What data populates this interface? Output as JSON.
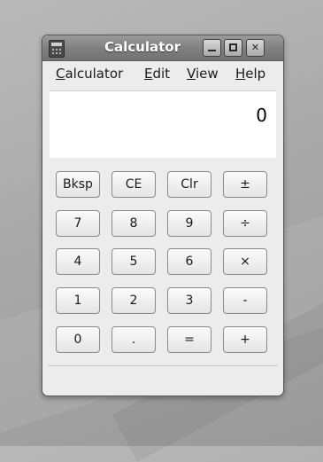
{
  "window": {
    "title": "Calculator",
    "controls": {
      "minimize": "minimize-icon",
      "maximize": "maximize-icon",
      "close": "✕"
    }
  },
  "menubar": {
    "items": [
      {
        "mnemonic": "C",
        "rest": "alculator"
      },
      {
        "mnemonic": "E",
        "rest": "dit"
      },
      {
        "mnemonic": "V",
        "rest": "iew"
      },
      {
        "mnemonic": "H",
        "rest": "elp"
      }
    ]
  },
  "display": {
    "value": "0"
  },
  "keypad": {
    "rows": [
      [
        "Bksp",
        "CE",
        "Clr",
        "±"
      ],
      [
        "7",
        "8",
        "9",
        "÷"
      ],
      [
        "4",
        "5",
        "6",
        "×"
      ],
      [
        "1",
        "2",
        "3",
        "-"
      ],
      [
        "0",
        ".",
        "=",
        "+"
      ]
    ]
  },
  "statusbar": {
    "text": ""
  }
}
